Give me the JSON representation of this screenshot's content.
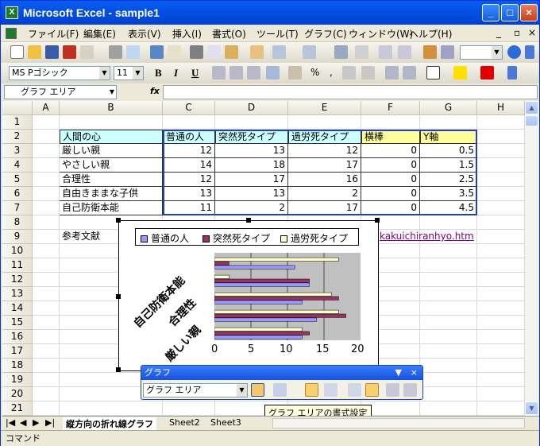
{
  "window": {
    "title": "Microsoft Excel - sample1",
    "app_icon": "X",
    "controls": {
      "minimize": "_",
      "maximize": "□",
      "close": "×"
    }
  },
  "menu": {
    "items": [
      "ファイル(F)",
      "編集(E)",
      "表示(V)",
      "挿入(I)",
      "書式(O)",
      "ツール(T)",
      "グラフ(C)",
      "ウィンドウ(W)",
      "ヘルプ(H)"
    ],
    "doc_controls": {
      "minimize": "_",
      "restore": "▫",
      "close": "×"
    }
  },
  "format_toolbar": {
    "font": "MS Pゴシック",
    "size": "11",
    "bold": "B",
    "italic": "I",
    "underline": "U",
    "percent": "%",
    "comma": ","
  },
  "formula_bar": {
    "name_box": "グラフ エリア",
    "fx": "fx",
    "content": ""
  },
  "columns": [
    "A",
    "B",
    "C",
    "D",
    "E",
    "F",
    "G",
    "H"
  ],
  "rows": [
    "1",
    "2",
    "3",
    "4",
    "5",
    "6",
    "7",
    "8",
    "9",
    "10",
    "11",
    "12",
    "13",
    "14",
    "15",
    "16",
    "17",
    "18",
    "19",
    "20",
    "21"
  ],
  "table": {
    "headers": [
      "人間の心",
      "普通の人",
      "突然死タイプ",
      "過労死タイプ",
      "横棒",
      "Y軸"
    ],
    "rows": [
      [
        "厳しい親",
        "12",
        "13",
        "12",
        "0",
        "0.5"
      ],
      [
        "やさしい親",
        "14",
        "18",
        "17",
        "0",
        "1.5"
      ],
      [
        "合理性",
        "12",
        "17",
        "16",
        "0",
        "2.5"
      ],
      [
        "自由きままな子供",
        "13",
        "13",
        "2",
        "0",
        "3.5"
      ],
      [
        "自己防衛本能",
        "11",
        "2",
        "17",
        "0",
        "4.5"
      ]
    ]
  },
  "reference": {
    "label": "参考文献",
    "link": "kakuichiranhyo.htm"
  },
  "chart_data": {
    "type": "bar",
    "orientation": "horizontal",
    "categories": [
      "厳しい親",
      "やさしい親",
      "合理性",
      "自由きままな子供",
      "自己防衛本能"
    ],
    "visible_category_labels": [
      "厳しい親",
      "合理性",
      "自己防衛本能"
    ],
    "series": [
      {
        "name": "普通の人",
        "values": [
          12,
          14,
          12,
          13,
          11
        ],
        "color": "#9999FF"
      },
      {
        "name": "突然死タイプ",
        "values": [
          13,
          18,
          17,
          13,
          2
        ],
        "color": "#993366"
      },
      {
        "name": "過労死タイプ",
        "values": [
          12,
          17,
          16,
          2,
          17
        ],
        "color": "#FFFFCC"
      }
    ],
    "xlim": [
      0,
      20
    ],
    "xticks": [
      "0",
      "5",
      "10",
      "15",
      "20"
    ],
    "legend": "top",
    "grid": true,
    "plot_background": "#C0C0C0"
  },
  "chart_toolbar": {
    "title": "グラフ",
    "selector": "グラフ エリア",
    "tooltip": "グラフ エリアの書式設定"
  },
  "sheet_tabs": [
    "縦方向の折れ線グラフ",
    "Sheet2",
    "Sheet3"
  ],
  "status": "コマンド"
}
